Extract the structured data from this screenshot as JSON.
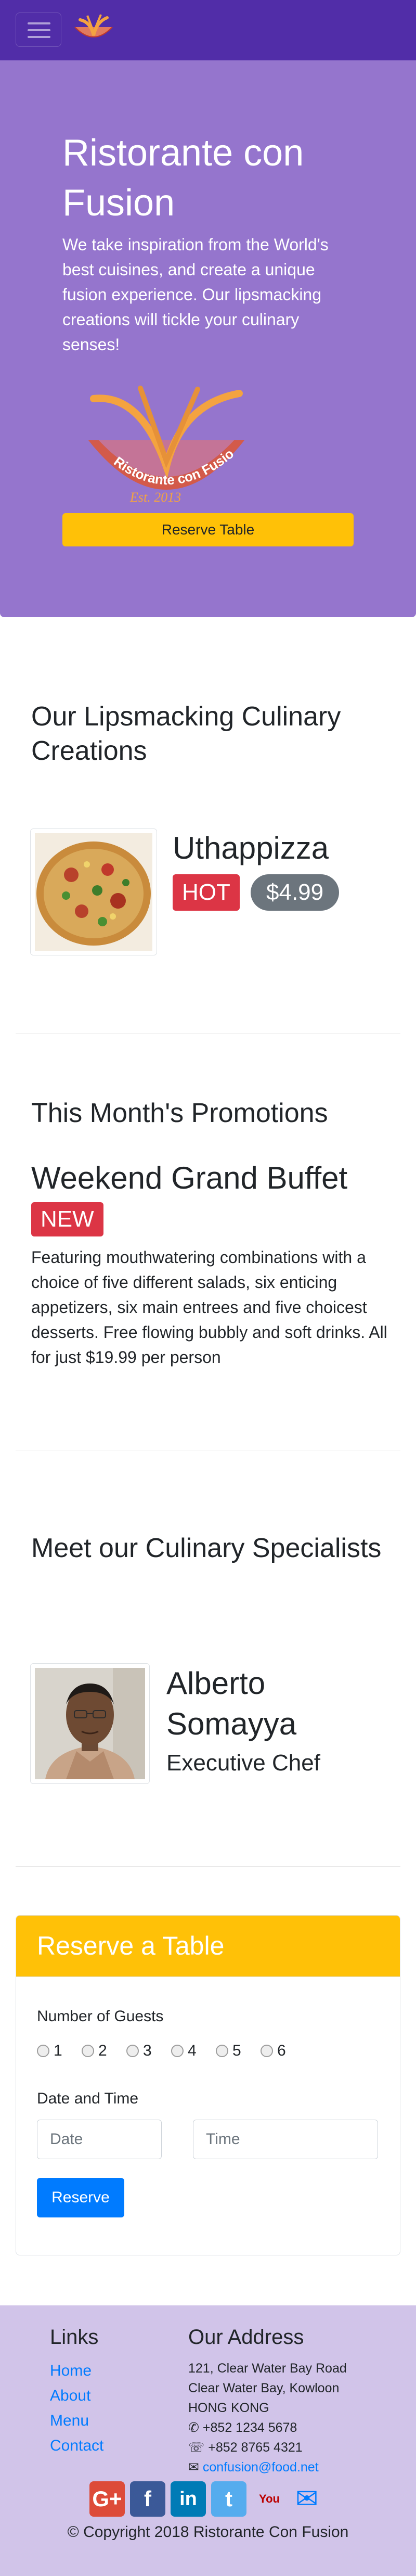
{
  "brand": {
    "primary": "#512da8",
    "jumbotron_bg": "#9575cd",
    "footer_bg": "#d1c4e9",
    "warning": "#ffc107",
    "danger": "#dc3545",
    "secondary": "#6c757d",
    "link": "#007bff"
  },
  "navbar": {
    "toggler_icon": "hamburger-menu-icon",
    "logo_icon": "restaurant-logo-icon"
  },
  "jumbotron": {
    "title": "Ristorante con Fusion",
    "text": "We take inspiration from the World's best cuisines, and create a unique fusion experience. Our lipsmacking creations will tickle your culinary senses!",
    "logo_text_top": "Ristorante con Fusion",
    "logo_text_bottom": "Est. 2013",
    "reserve_label": "Reserve Table"
  },
  "dishes": {
    "heading": "Our Lipsmacking Culinary Creations",
    "featured": {
      "name": "Uthappizza",
      "label": "HOT",
      "price": "$4.99"
    }
  },
  "promotions": {
    "heading": "This Month's Promotions",
    "featured": {
      "name": "Weekend Grand Buffet",
      "label": "NEW",
      "description": "Featuring mouthwatering combinations with a choice of five different salads, six enticing appetizers, six main entrees and five choicest desserts. Free flowing bubbly and soft drinks. All for just $19.99 per person"
    }
  },
  "leaders": {
    "heading": "Meet our Culinary Specialists",
    "featured": {
      "name": "Alberto Somayya",
      "designation": "Executive Chef"
    }
  },
  "reservation": {
    "title": "Reserve a Table",
    "guests_label": "Number of Guests",
    "guest_options": [
      "1",
      "2",
      "3",
      "4",
      "5",
      "6"
    ],
    "datetime_label": "Date and Time",
    "date_placeholder": "Date",
    "time_placeholder": "Time",
    "submit_label": "Reserve"
  },
  "footer": {
    "links_heading": "Links",
    "links": [
      "Home",
      "About",
      "Menu",
      "Contact"
    ],
    "address_heading": "Our Address",
    "address_lines": [
      "121, Clear Water Bay Road",
      "Clear Water Bay, Kowloon",
      "HONG KONG"
    ],
    "phone": "+852 1234 5678",
    "fax": "+852 8765 4321",
    "email": "confusion@food.net",
    "social": [
      {
        "name": "google-plus-icon",
        "glyph": "G+",
        "color": "#dd4b39"
      },
      {
        "name": "facebook-icon",
        "glyph": "f",
        "color": "#3b5998"
      },
      {
        "name": "linkedin-icon",
        "glyph": "in",
        "color": "#007bb6"
      },
      {
        "name": "twitter-icon",
        "glyph": "t",
        "color": "#55acee"
      },
      {
        "name": "youtube-icon",
        "glyph": "You",
        "color": "#bb0000"
      },
      {
        "name": "mail-icon",
        "glyph": "✉",
        "color": "#007bff"
      }
    ],
    "copyright": "© Copyright 2018 Ristorante Con Fusion"
  }
}
